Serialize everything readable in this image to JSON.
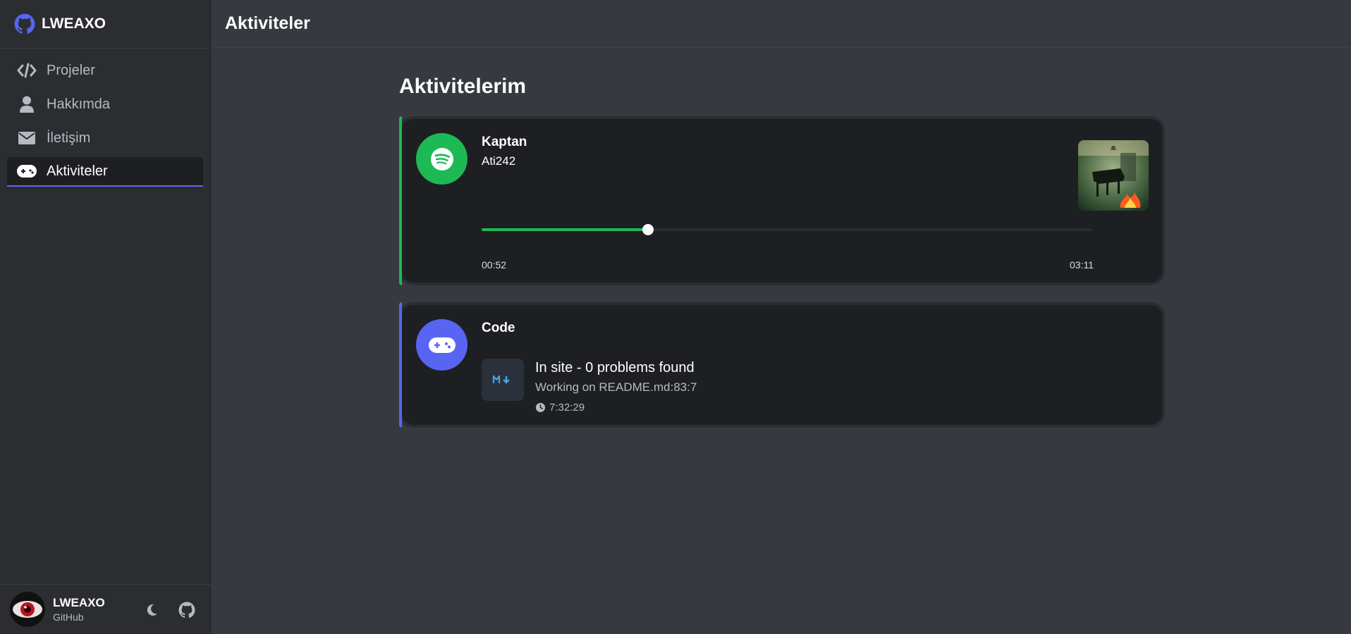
{
  "brand": {
    "name": "LWEAXO",
    "logo_icon": "github-icon"
  },
  "sidebar": {
    "items": [
      {
        "label": "Projeler",
        "icon": "code-icon"
      },
      {
        "label": "Hakkımda",
        "icon": "user-icon"
      },
      {
        "label": "İletişim",
        "icon": "envelope-icon"
      },
      {
        "label": "Aktiviteler",
        "icon": "gamepad-icon",
        "active": true
      }
    ]
  },
  "user": {
    "name": "LWEAXO",
    "subtitle": "GitHub",
    "theme_icon": "moon-icon",
    "github_icon": "github-icon"
  },
  "header": {
    "title": "Aktiviteler"
  },
  "main": {
    "title": "Aktivitelerim",
    "spotify": {
      "icon": "spotify-icon",
      "accent": "#1db954",
      "song": "Kaptan",
      "artist": "Ati242",
      "elapsed": "00:52",
      "duration": "03:11",
      "progress": 0.272
    },
    "code": {
      "icon": "gamepad-icon",
      "accent": "#5865f2",
      "title": "Code",
      "file_icon": "markdown-icon",
      "state": "In site - 0 problems found",
      "details": "Working on README.md:83:7",
      "time": "7:32:29",
      "time_icon": "clock-icon"
    }
  },
  "colors": {
    "background": "#36393f",
    "sidebar": "#2b2d31",
    "card": "#1e1f22",
    "spotify_green": "#1db954",
    "blurple": "#5865f2"
  }
}
